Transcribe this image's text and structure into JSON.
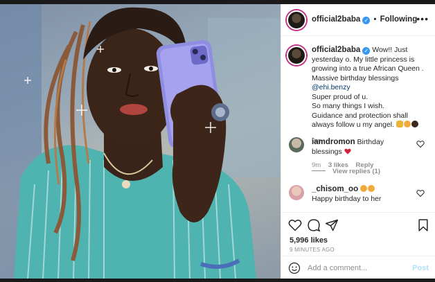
{
  "post": {
    "username": "official2baba",
    "follow_status": "Following",
    "separator": "•",
    "more_options": "•••"
  },
  "caption": {
    "username": "official2baba",
    "text_1": "Wow!! Just yesterday o. My little princess is growing into a true African Queen .",
    "text_2": "Massive birthday blessings",
    "mention": "@ehi.benzy",
    "text_3": "Super proud of u.",
    "text_4": "So many things I wish.",
    "text_5": "Guidance and protection shall always follow u my angel.",
    "time": "9m"
  },
  "comments": [
    {
      "username": "iamdromon",
      "text": "Birthday blessings",
      "time": "9m",
      "likes": "3 likes",
      "reply": "Reply",
      "view_replies": "View replies (1)"
    },
    {
      "username": "_chisom_oo",
      "text": "Happy birthday to her"
    }
  ],
  "engagement": {
    "likes": "5,996 likes",
    "posted_ago": "9 MINUTES AGO"
  },
  "add_comment": {
    "placeholder": "Add a comment...",
    "post_label": "Post"
  },
  "icons": {
    "like": "heart-icon",
    "comment": "comment-icon",
    "share": "share-icon",
    "save": "bookmark-icon",
    "emoji": "smile-icon"
  },
  "colors": {
    "verified": "#3897f0",
    "mention": "#00376b",
    "heart": "#ed4956",
    "post_disabled": "#b2dffc"
  }
}
